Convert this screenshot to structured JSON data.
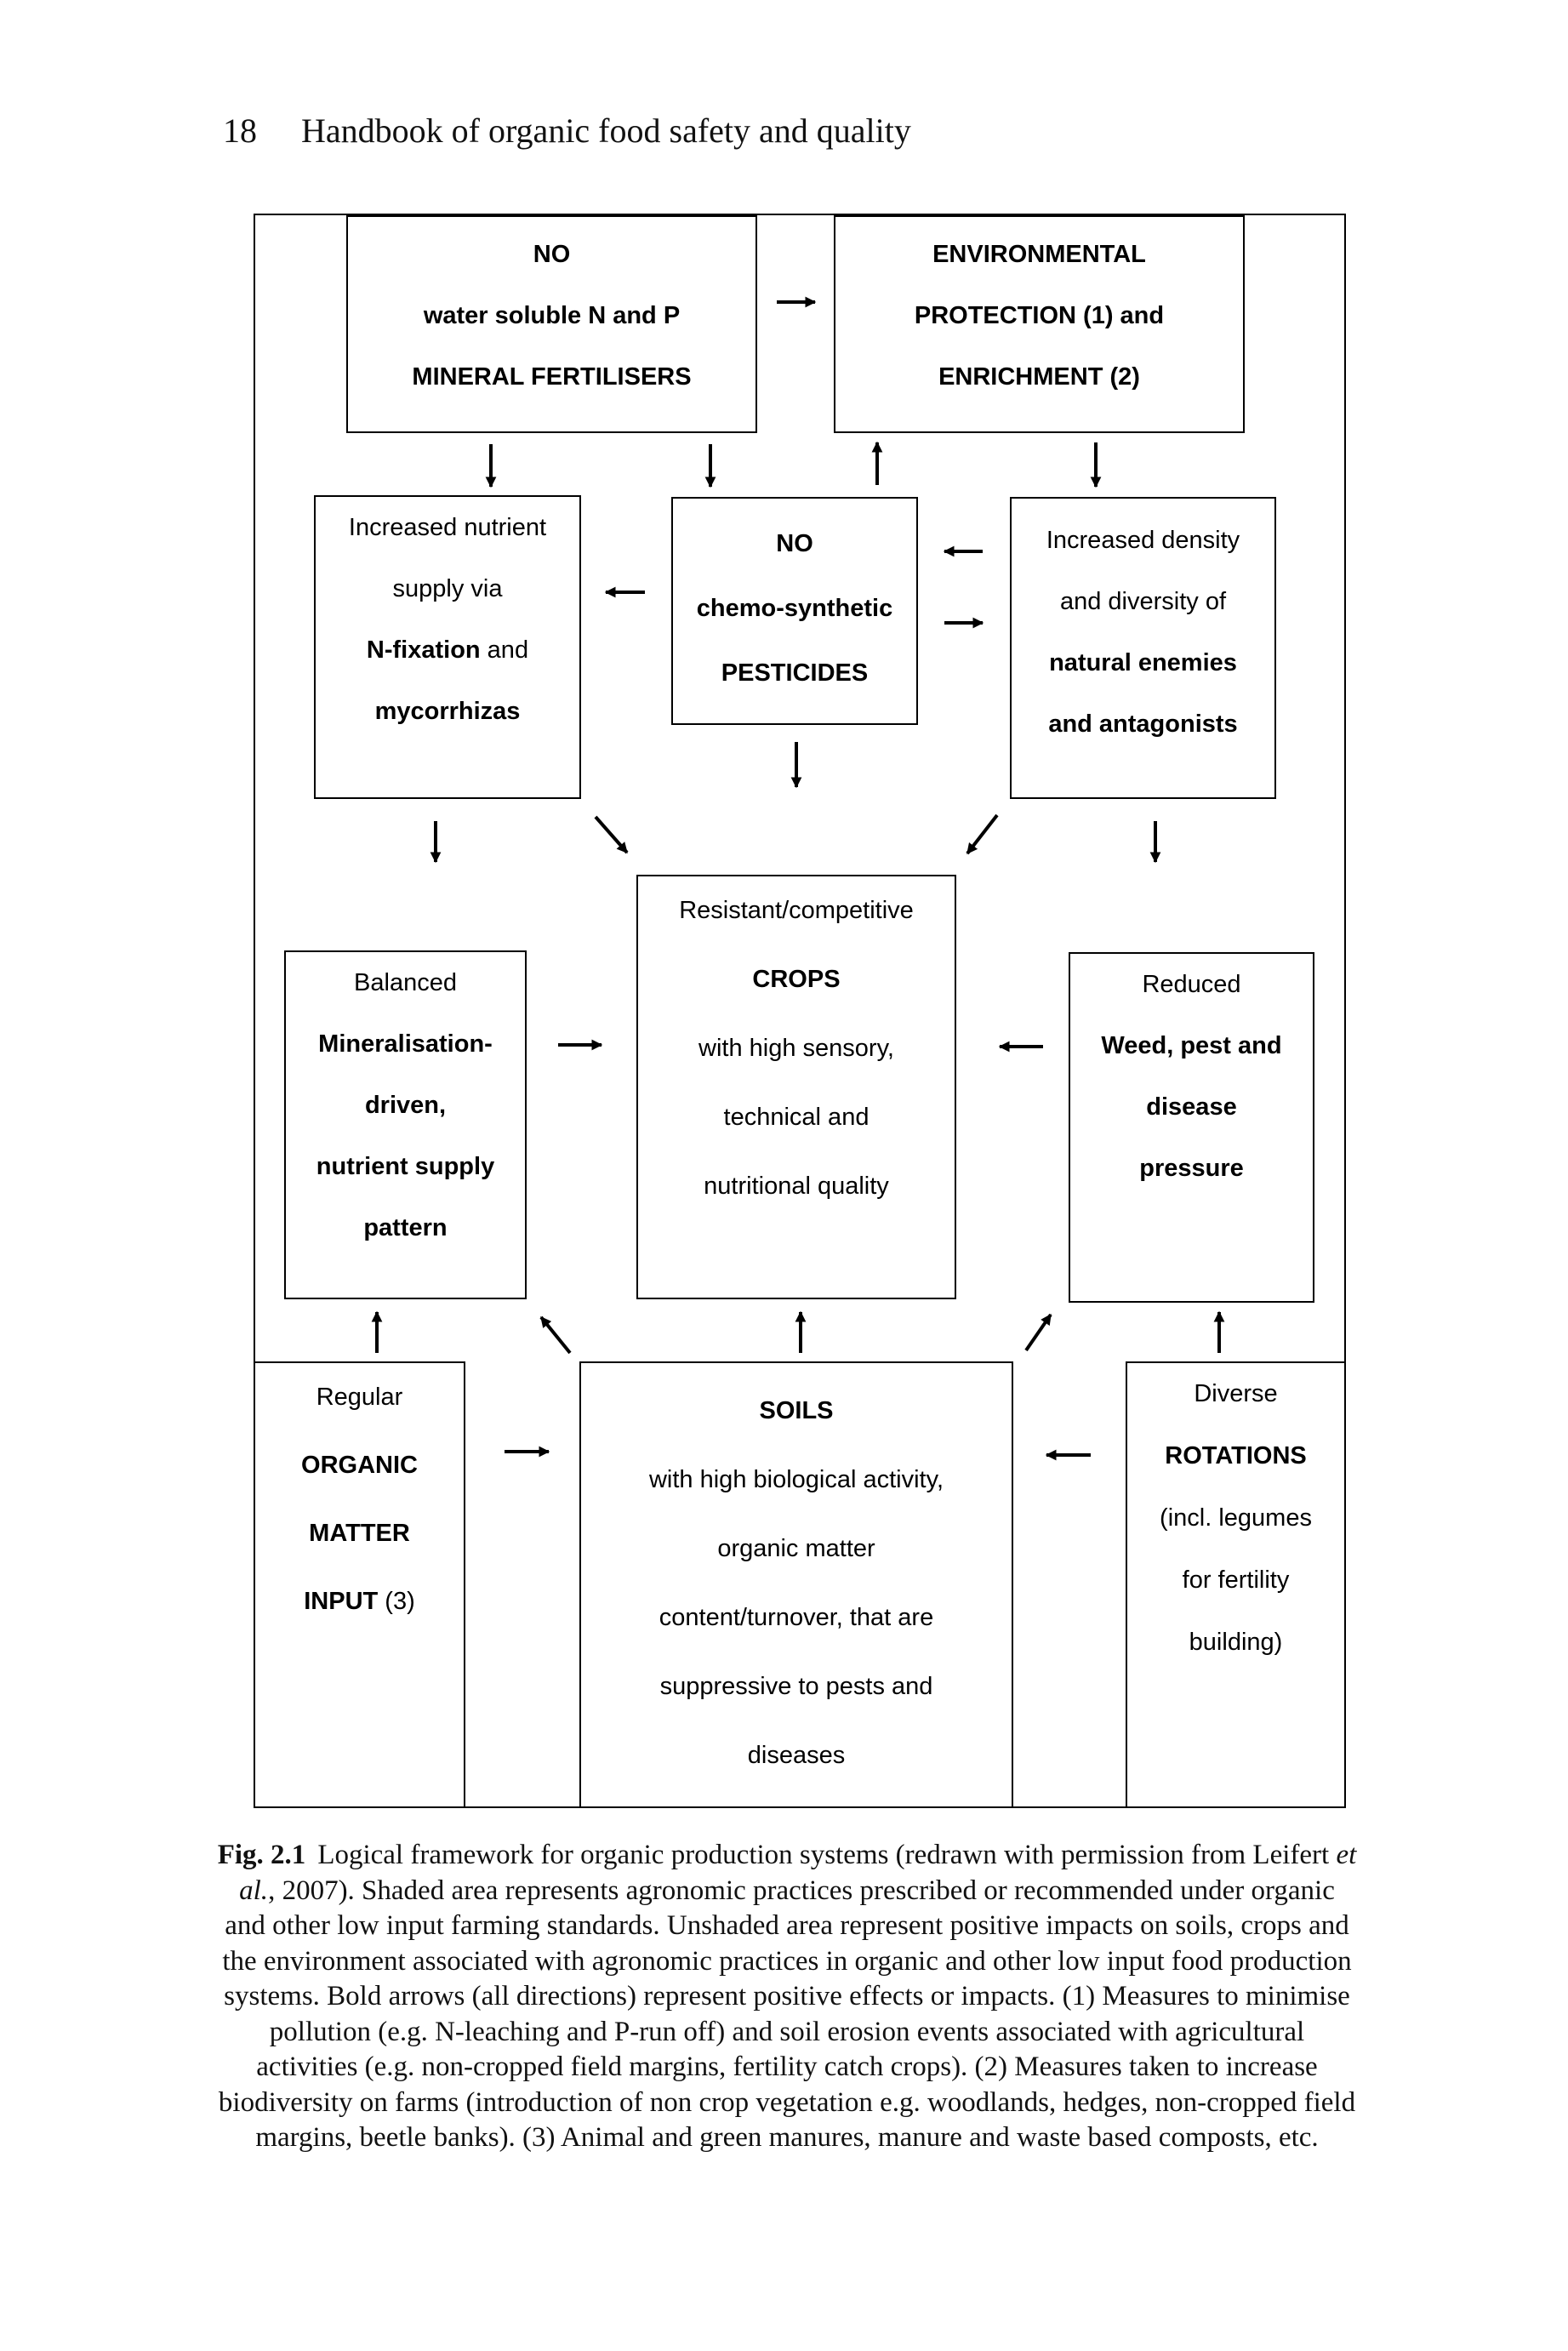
{
  "header": {
    "page_number": "18",
    "running_title": "Handbook of organic food safety and quality"
  },
  "diagram": {
    "boxes": {
      "mineral_fertilisers": {
        "lines": [
          [
            {
              "text": "NO",
              "bold": true
            }
          ],
          [
            {
              "text": "water soluble N and P",
              "bold": true
            }
          ],
          [
            {
              "text": "MINERAL FERTILISERS",
              "bold": true
            }
          ]
        ]
      },
      "environmental_protection": {
        "lines": [
          [
            {
              "text": "ENVIRONMENTAL",
              "bold": true
            }
          ],
          [
            {
              "text": "PROTECTION (1) and",
              "bold": true
            }
          ],
          [
            {
              "text": "ENRICHMENT (2)",
              "bold": true
            }
          ]
        ]
      },
      "nutrient_supply": {
        "lines": [
          [
            {
              "text": "Increased nutrient",
              "bold": false
            }
          ],
          [
            {
              "text": "supply via",
              "bold": false
            }
          ],
          [
            {
              "text": "N-fixation",
              "bold": true
            },
            {
              "text": " and",
              "bold": false
            }
          ],
          [
            {
              "text": "mycorrhizas",
              "bold": true
            }
          ]
        ]
      },
      "pesticides": {
        "lines": [
          [
            {
              "text": "NO",
              "bold": true
            }
          ],
          [
            {
              "text": "chemo-synthetic",
              "bold": true
            }
          ],
          [
            {
              "text": "PESTICIDES",
              "bold": true
            }
          ]
        ]
      },
      "natural_enemies": {
        "lines": [
          [
            {
              "text": "Increased density",
              "bold": false
            }
          ],
          [
            {
              "text": "and diversity of",
              "bold": false
            }
          ],
          [
            {
              "text": "natural enemies",
              "bold": true
            }
          ],
          [
            {
              "text": "and antagonists",
              "bold": true
            }
          ]
        ]
      },
      "mineralisation": {
        "lines": [
          [
            {
              "text": "Balanced",
              "bold": false
            }
          ],
          [
            {
              "text": "Mineralisation-",
              "bold": true
            }
          ],
          [
            {
              "text": "driven,",
              "bold": true
            }
          ],
          [
            {
              "text": "nutrient supply",
              "bold": true
            }
          ],
          [
            {
              "text": "pattern",
              "bold": true
            }
          ]
        ]
      },
      "crops": {
        "lines": [
          [
            {
              "text": "Resistant/competitive",
              "bold": false
            }
          ],
          [
            {
              "text": "CROPS",
              "bold": true
            }
          ],
          [
            {
              "text": "with high sensory,",
              "bold": false
            }
          ],
          [
            {
              "text": "technical and",
              "bold": false
            }
          ],
          [
            {
              "text": "nutritional quality",
              "bold": false
            }
          ]
        ]
      },
      "weed_pressure": {
        "lines": [
          [
            {
              "text": "Reduced",
              "bold": false
            }
          ],
          [
            {
              "text": "Weed, pest and",
              "bold": true
            }
          ],
          [
            {
              "text": "disease",
              "bold": true
            }
          ],
          [
            {
              "text": "pressure",
              "bold": true
            }
          ]
        ]
      },
      "organic_matter": {
        "lines": [
          [
            {
              "text": "Regular",
              "bold": false
            }
          ],
          [
            {
              "text": "ORGANIC",
              "bold": true
            }
          ],
          [
            {
              "text": "MATTER",
              "bold": true
            }
          ],
          [
            {
              "text": "INPUT",
              "bold": true
            },
            {
              "text": " (3)",
              "bold": false
            }
          ]
        ]
      },
      "soils": {
        "lines": [
          [
            {
              "text": "SOILS",
              "bold": true
            }
          ],
          [
            {
              "text": "with high biological activity,",
              "bold": false
            }
          ],
          [
            {
              "text": "organic matter",
              "bold": false
            }
          ],
          [
            {
              "text": "content/turnover, that are",
              "bold": false
            }
          ],
          [
            {
              "text": "suppressive to pests and",
              "bold": false
            }
          ],
          [
            {
              "text": "diseases",
              "bold": false
            }
          ]
        ]
      },
      "rotations": {
        "lines": [
          [
            {
              "text": "Diverse",
              "bold": false
            }
          ],
          [
            {
              "text": "ROTATIONS",
              "bold": true
            }
          ],
          [
            {
              "text": "(incl. legumes",
              "bold": false
            }
          ],
          [
            {
              "text": "for fertility",
              "bold": false
            }
          ],
          [
            {
              "text": "building)",
              "bold": false
            }
          ]
        ]
      }
    },
    "arrows": [
      {
        "from": "mineral_fertilisers",
        "to": "environmental_protection",
        "direction": "right"
      },
      {
        "from": "mineral_fertilisers",
        "to": "nutrient_supply",
        "direction": "down"
      },
      {
        "from": "mineral_fertilisers",
        "to": "pesticides",
        "direction": "down"
      },
      {
        "from": "pesticides",
        "to": "environmental_protection",
        "direction": "up"
      },
      {
        "from": "environmental_protection",
        "to": "natural_enemies",
        "direction": "down"
      },
      {
        "from": "pesticides",
        "to": "nutrient_supply",
        "direction": "left"
      },
      {
        "from": "natural_enemies",
        "to": "pesticides",
        "direction": "left"
      },
      {
        "from": "pesticides",
        "to": "natural_enemies",
        "direction": "right"
      },
      {
        "from": "pesticides",
        "to": "crops",
        "direction": "down"
      },
      {
        "from": "nutrient_supply",
        "to": "mineralisation",
        "direction": "down"
      },
      {
        "from": "nutrient_supply",
        "to": "crops",
        "direction": "down-right"
      },
      {
        "from": "natural_enemies",
        "to": "crops",
        "direction": "down-left"
      },
      {
        "from": "natural_enemies",
        "to": "weed_pressure",
        "direction": "down"
      },
      {
        "from": "mineralisation",
        "to": "crops",
        "direction": "right"
      },
      {
        "from": "weed_pressure",
        "to": "crops",
        "direction": "left"
      },
      {
        "from": "organic_matter",
        "to": "mineralisation",
        "direction": "up"
      },
      {
        "from": "soils",
        "to": "mineralisation",
        "direction": "up-left"
      },
      {
        "from": "soils",
        "to": "crops",
        "direction": "up"
      },
      {
        "from": "soils",
        "to": "weed_pressure",
        "direction": "up-right"
      },
      {
        "from": "rotations",
        "to": "weed_pressure",
        "direction": "up"
      },
      {
        "from": "organic_matter",
        "to": "soils",
        "direction": "right"
      },
      {
        "from": "rotations",
        "to": "soils",
        "direction": "left"
      }
    ]
  },
  "caption": {
    "figure_label": "Fig. 2.1",
    "text_before_italic": "Logical framework for organic production systems (redrawn with permission from Leifert ",
    "italic": "et al.",
    "text_after_italic": ", 2007). Shaded area represents agronomic practices prescribed or recommended under organic and other low input farming standards. Unshaded area represent positive impacts on soils, crops and the environment associated with agronomic practices in organic and other low input food production systems. Bold arrows (all directions) represent positive effects or impacts. (1) Measures to minimise pollution (e.g. N-leaching and P-run off) and soil erosion events associated with agricultural activities (e.g. non-cropped field margins, fertility catch crops). (2) Measures taken to increase biodiversity on farms (introduction of non crop vegetation e.g. woodlands, hedges, non-cropped field margins, beetle banks). (3) Animal and green manures, manure and waste based composts, etc."
  }
}
